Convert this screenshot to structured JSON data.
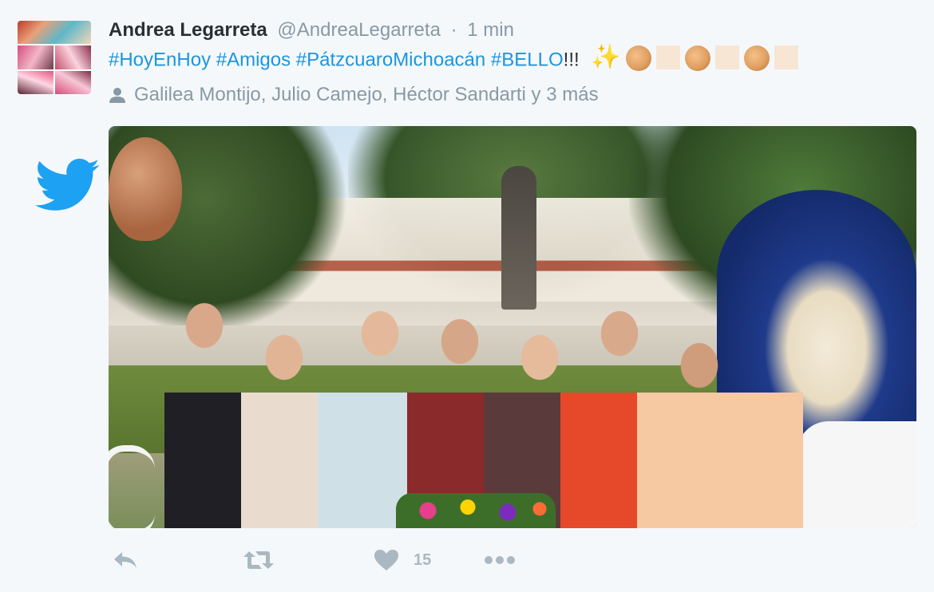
{
  "tweet": {
    "author_name": "Andrea Legarreta",
    "author_handle": "@AndreaLegarreta",
    "separator": "·",
    "timestamp": "1 min",
    "text": {
      "hashtags": [
        "#HoyEnHoy",
        "#Amigos",
        "#PátzcuaroMichoacán",
        "#BELLO"
      ],
      "trailing": "!!!",
      "emojis": [
        "sparkles",
        "clapping-hands",
        "skin-tone-box",
        "clapping-hands",
        "skin-tone-box",
        "clapping-hands",
        "skin-tone-box"
      ]
    },
    "tagged_people": "Galilea Montijo, Julio Camejo, Héctor Sandarti y 3 más",
    "like_count": "15"
  },
  "icons": {
    "brand": "twitter-bird-icon",
    "tagged": "person-icon",
    "reply": "reply-icon",
    "retweet": "retweet-icon",
    "like": "heart-icon",
    "more": "more-icon"
  },
  "colors": {
    "brand_blue": "#1da1f2",
    "hashtag": "#1b95e0",
    "text": "#292f33",
    "muted": "#8899a6",
    "action_gray": "#aab8c2",
    "background": "#f5f8fa"
  }
}
